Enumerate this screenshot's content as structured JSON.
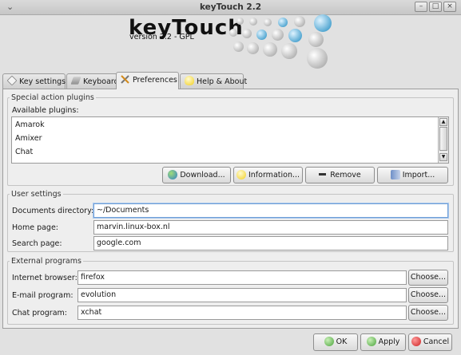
{
  "window": {
    "title": "keyTouch 2.2"
  },
  "header": {
    "logo_text": "keyTouch",
    "version": "version 2.2 - GPL"
  },
  "tabs": [
    {
      "label": "Key settings",
      "icon": "key-icon",
      "active": false
    },
    {
      "label": "Keyboard",
      "icon": "keyboard-icon",
      "active": false
    },
    {
      "label": "Preferences",
      "icon": "tools-icon",
      "active": true
    },
    {
      "label": "Help & About",
      "icon": "lightbulb-icon",
      "active": false
    }
  ],
  "plugins": {
    "section_title": "Special action plugins",
    "list_label": "Available plugins:",
    "items": [
      "Amarok",
      "Amixer",
      "Chat"
    ],
    "buttons": {
      "download": "Download...",
      "information": "Information...",
      "remove": "Remove",
      "import": "Import..."
    }
  },
  "user_settings": {
    "section_title": "User settings",
    "documents_label": "Documents directory:",
    "documents_value": "~/Documents",
    "home_label": "Home page:",
    "home_value": "marvin.linux-box.nl",
    "search_label": "Search page:",
    "search_value": "google.com"
  },
  "external_programs": {
    "section_title": "External programs",
    "browser_label": "Internet browser:",
    "browser_value": "firefox",
    "email_label": "E-mail program:",
    "email_value": "evolution",
    "chat_label": "Chat program:",
    "chat_value": "xchat",
    "choose_label": "Choose..."
  },
  "dialog_buttons": {
    "ok": "OK",
    "apply": "Apply",
    "cancel": "Cancel"
  },
  "colors": {
    "accent_focus": "#6f9ed6",
    "ok_icon": "#4aa33a",
    "cancel_icon": "#cc2222"
  }
}
